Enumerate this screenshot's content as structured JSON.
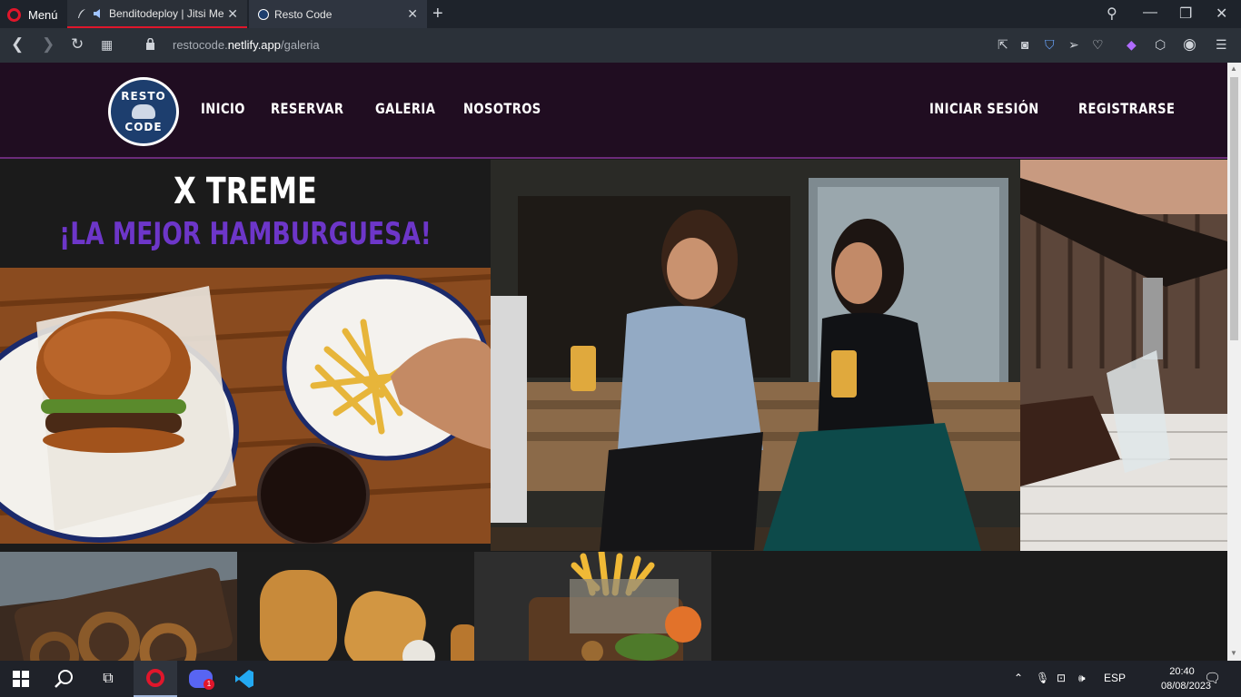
{
  "browser": {
    "menu_label": "Menú",
    "tabs": [
      {
        "title": "Benditodeploy | Jitsi Me"
      },
      {
        "title": "Resto Code"
      }
    ],
    "url_prefix": "restocode.",
    "url_domain": "netlify.app",
    "url_path": "/galeria"
  },
  "site": {
    "logo": {
      "top": "RESTO",
      "bottom": "CODE"
    },
    "nav_left": [
      "INICIO",
      "RESERVAR",
      "GALERIA",
      "NOSOTROS"
    ],
    "nav_right": [
      "INICIAR SESIÓN",
      "REGISTRARSE"
    ],
    "hero_title": "X TREME",
    "hero_subtitle": "¡LA MEJOR HAMBURGUESA!"
  },
  "colors": {
    "nav_bg": "#200d21",
    "accent_purple": "#6d36c9",
    "page_bg": "#1b1b1b"
  },
  "taskbar": {
    "language": "ESP",
    "time": "20:40",
    "date": "08/08/2023",
    "discord_badge": "1"
  }
}
